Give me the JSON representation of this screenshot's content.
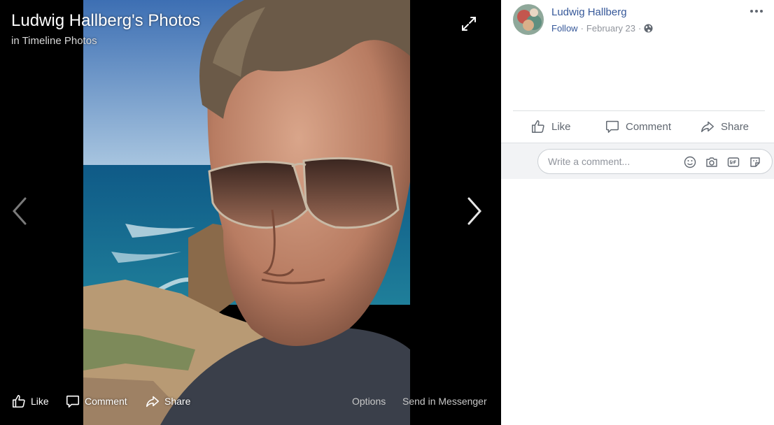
{
  "viewer": {
    "title": "Ludwig Hallberg's Photos",
    "subtitle": "in Timeline Photos",
    "actions": {
      "like": "Like",
      "comment": "Comment",
      "share": "Share",
      "options": "Options",
      "send": "Send in Messenger"
    }
  },
  "post": {
    "author": "Ludwig Hallberg",
    "follow": "Follow",
    "separator": "·",
    "date": "February 23",
    "separator2": "·",
    "privacy_icon": "globe-icon"
  },
  "post_actions": {
    "like": "Like",
    "comment": "Comment",
    "share": "Share"
  },
  "comment": {
    "placeholder": "Write a comment...",
    "icons": [
      "emoji-icon",
      "camera-icon",
      "gif-icon",
      "sticker-icon"
    ]
  },
  "colors": {
    "link": "#365899",
    "muted": "#90949c",
    "viewer_bg": "#000000"
  }
}
